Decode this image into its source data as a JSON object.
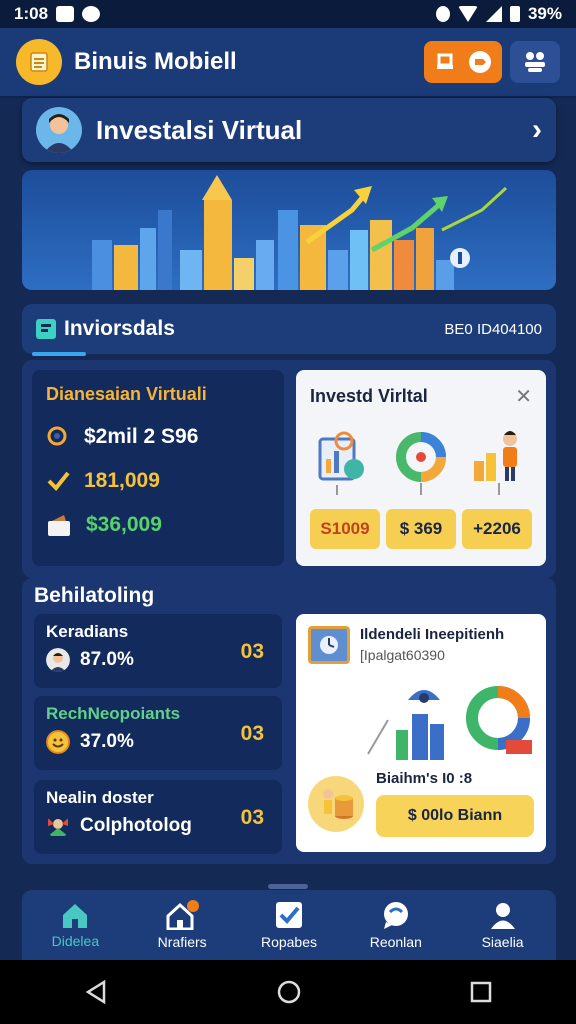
{
  "status": {
    "time": "1:08",
    "battery": "39%"
  },
  "app": {
    "title": "Binuis Mobiell"
  },
  "investasi": {
    "title": "Investalsi Virtual"
  },
  "section": {
    "label": "Inviorsdals",
    "code": "BE0 ID404100"
  },
  "dianesaian": {
    "title": "Dianesaian Virtuali",
    "rows": [
      {
        "icon": "search-icon",
        "value": "$2mil 2 S96"
      },
      {
        "icon": "check-icon",
        "value": "181,009"
      },
      {
        "icon": "wallet-icon",
        "value": "$36,009"
      }
    ]
  },
  "investd": {
    "title": "Investd Virltal",
    "values": [
      "S1009",
      "$ 369",
      "+2206"
    ]
  },
  "behilatoling": {
    "title": "Behilatoling",
    "items": [
      {
        "name": "Keradians",
        "pct": "87.0%",
        "badge": "03"
      },
      {
        "name": "RechNeopoiants",
        "pct": "37.0%",
        "badge": "03"
      },
      {
        "name": "Nealin doster",
        "pct": "Colphotolog",
        "badge": "03"
      }
    ]
  },
  "info": {
    "title": "Ildendeli Ineepitienh",
    "subtitle": "[Ipalgat60390",
    "label": "Biaihm's I0 :8",
    "pill": "$ 00lo Biann"
  },
  "nav": [
    {
      "label": "Didelea",
      "active": true
    },
    {
      "label": "Nrafiers",
      "active": false
    },
    {
      "label": "Ropabes",
      "active": false
    },
    {
      "label": "Reonlan",
      "active": false
    },
    {
      "label": "Siaelia",
      "active": false
    }
  ],
  "colors": {
    "accent": "#f5c23a",
    "teal": "#48c7c3",
    "orange": "#f07d1a",
    "bg": "#142a55"
  }
}
